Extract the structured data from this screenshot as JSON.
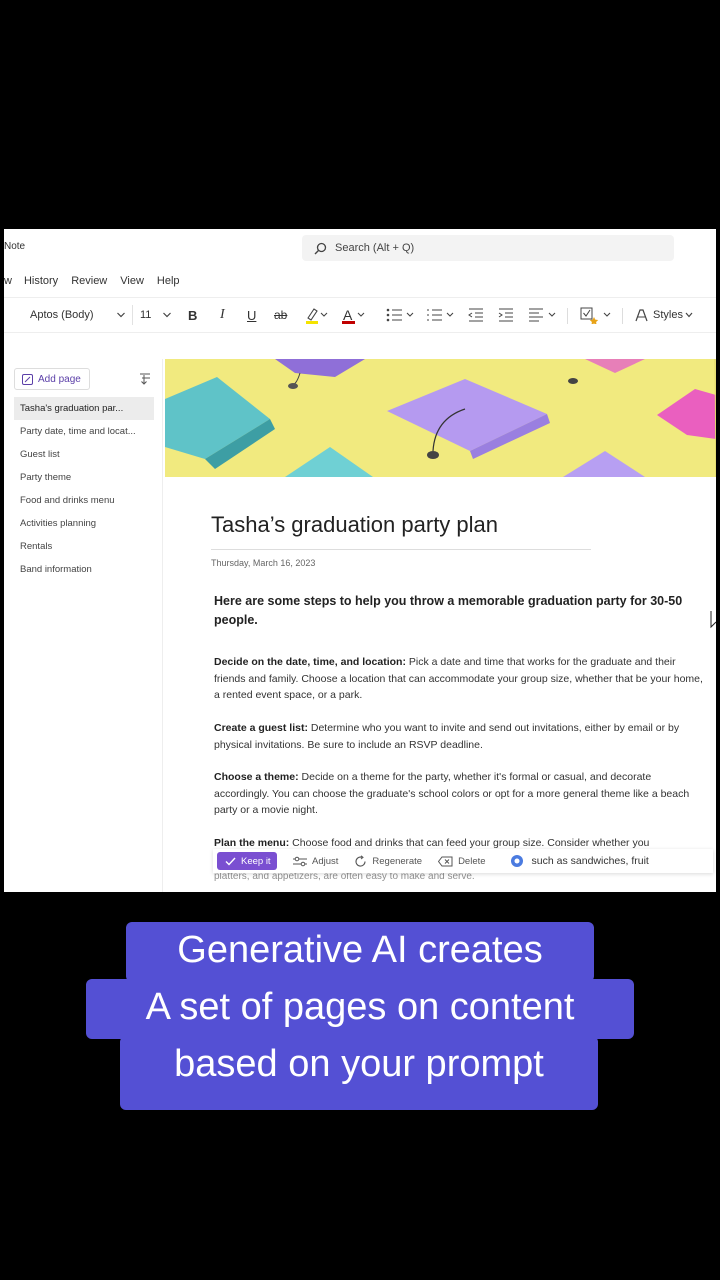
{
  "app": {
    "name": "Note",
    "search_placeholder": "Search (Alt + Q)"
  },
  "menu": [
    "w",
    "History",
    "Review",
    "View",
    "Help"
  ],
  "toolbar": {
    "font": "Aptos (Body)",
    "size": "11",
    "bold": "B",
    "italic": "I",
    "underline": "U",
    "strike": "ab",
    "font_color_letter": "A",
    "styles": "Styles"
  },
  "pages": {
    "add_label": "Add page",
    "items": [
      "Tasha's graduation par...",
      "Party date, time and locat...",
      "Guest list",
      "Party theme",
      "Food and drinks menu",
      "Activities planning",
      "Rentals",
      "Band information"
    ]
  },
  "note": {
    "title": "Tasha’s graduation party plan",
    "date": "Thursday, March 16, 2023",
    "intro": "Here are some steps to help you throw a memorable graduation party for 30-50 people.",
    "paragraphs": [
      {
        "head": "Decide on the date, time, and location:",
        "body": " Pick a date and time that works for the graduate and their friends and family. Choose a location that can accommodate your group size, whether that be your home, a rented event space, or a park."
      },
      {
        "head": "Create a guest list:",
        "body": " Determine who you want to invite and send out invitations, either by email or by physical invitations. Be sure to include an RSVP deadline."
      },
      {
        "head": "Choose a theme:",
        "body": " Decide on a theme for the party, whether it's formal or casual, and decorate accordingly. You can choose the graduate's school colors or opt for a more general theme like a beach party or a movie night."
      },
      {
        "head": "Plan the menu:",
        "body": " Choose food and drinks that can feed your group size. Consider whether you"
      },
      {
        "head": "",
        "body": "platters, and appetizers, are often easy to make and serve."
      }
    ]
  },
  "ai_bar": {
    "keep": "Keep it",
    "adjust": "Adjust",
    "regenerate": "Regenerate",
    "delete": "Delete",
    "tail": "such as sandwiches, fruit"
  },
  "caption": [
    "Generative AI creates",
    "A set of pages on content",
    "based on your prompt"
  ]
}
